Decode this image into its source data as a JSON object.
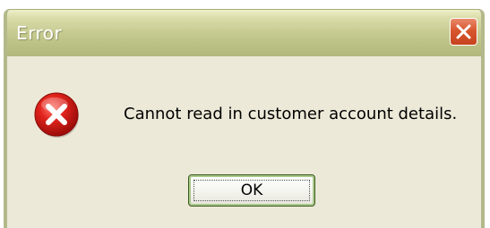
{
  "dialog": {
    "title": "Error",
    "message": "Cannot read in customer account details.",
    "ok_label": "OK",
    "icon": "error-icon",
    "close_icon": "close-icon"
  },
  "colors": {
    "dialog_background": "#ece9d8",
    "titlebar": "#c9cd95",
    "close_button": "#d9572f",
    "error_icon": "#d21a1a",
    "button_focus_border": "#a9c88a"
  }
}
